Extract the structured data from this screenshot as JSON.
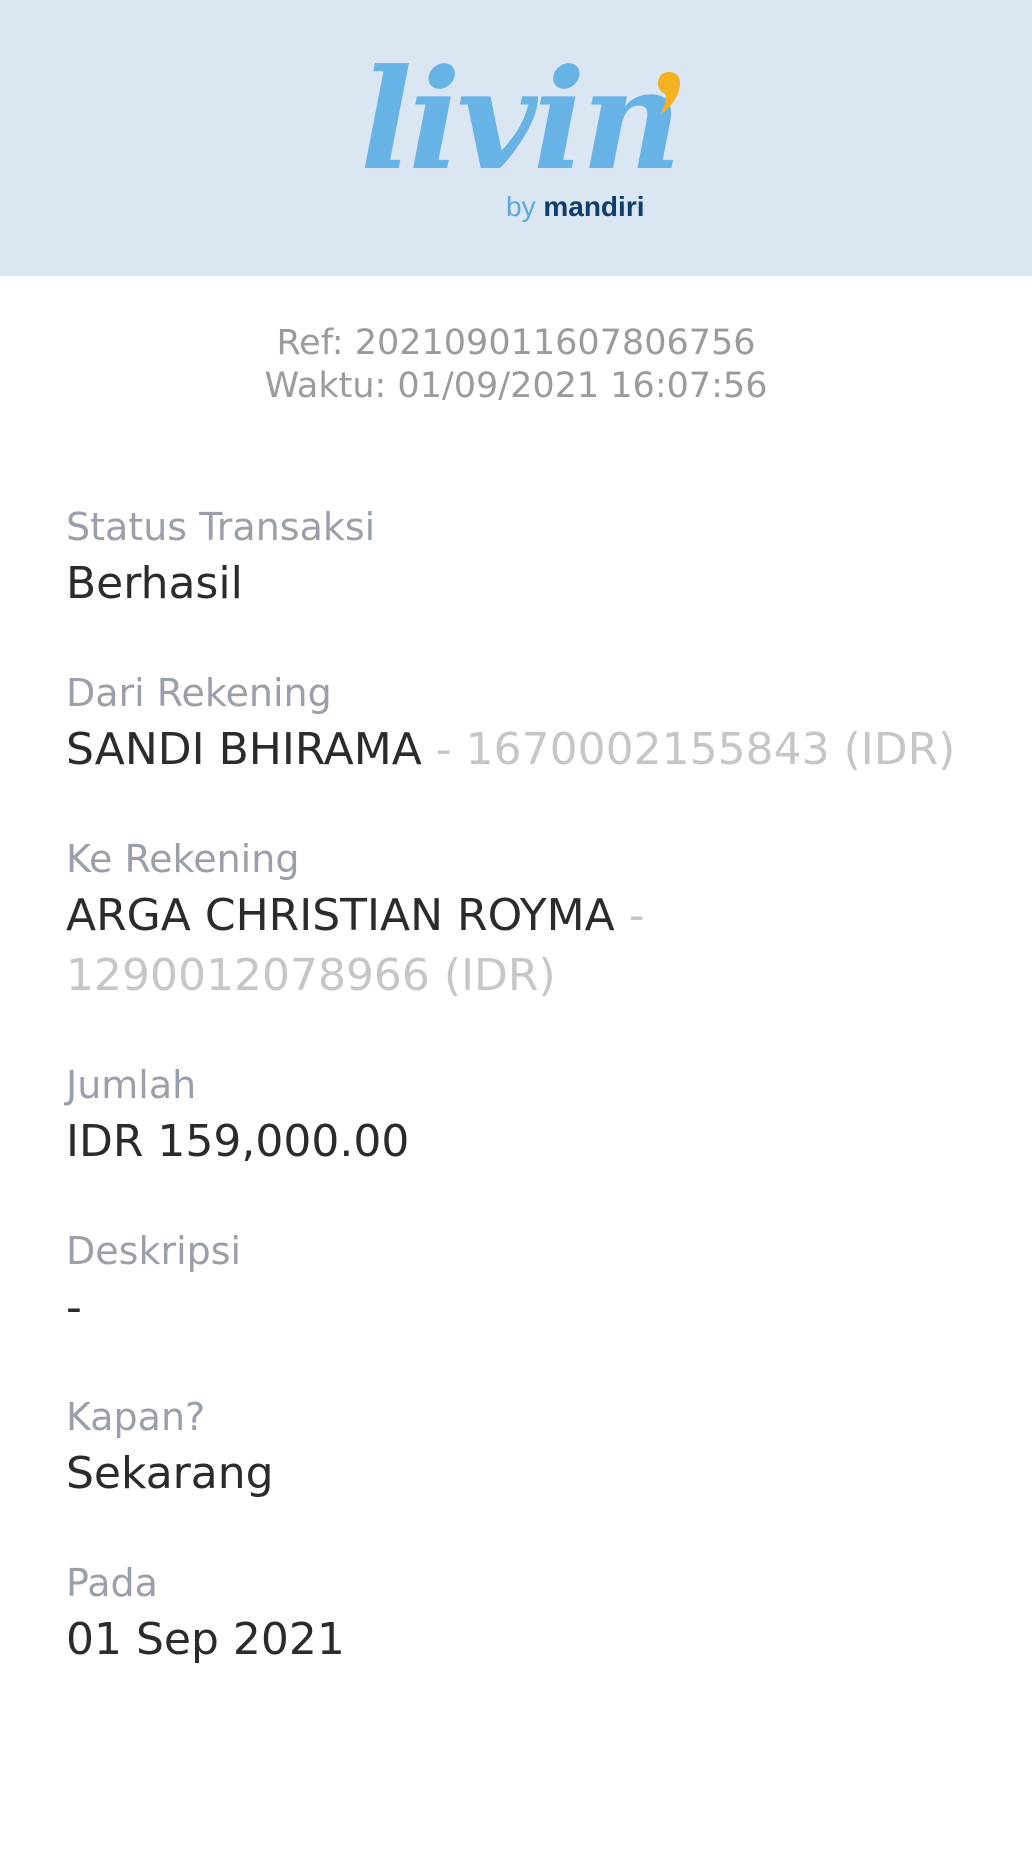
{
  "header": {
    "logo_word": "livin",
    "logo_by": "by",
    "logo_brand": "mandiri",
    "background_color": "#dae7f3",
    "accent_color": "#67b3e6",
    "comma_color": "#f5b324"
  },
  "receipt": {
    "ref": "Ref: 202109011607806756",
    "time": "Waktu: 01/09/2021 16:07:56"
  },
  "fields": {
    "status": {
      "label": "Status Transaksi",
      "value": "Berhasil"
    },
    "from": {
      "label": "Dari Rekening",
      "name": "SANDI BHIRAMA",
      "account": " - 1670002155843 (IDR)"
    },
    "to": {
      "label": "Ke Rekening",
      "name": "ARGA CHRISTIAN ROYMA",
      "account": " - 1290012078966 (IDR)"
    },
    "amount": {
      "label": "Jumlah",
      "value": "IDR 159,000.00"
    },
    "description": {
      "label": "Deskripsi",
      "value": "-"
    },
    "when": {
      "label": "Kapan?",
      "value": "Sekarang"
    },
    "date": {
      "label": "Pada",
      "value": "01 Sep 2021"
    }
  }
}
